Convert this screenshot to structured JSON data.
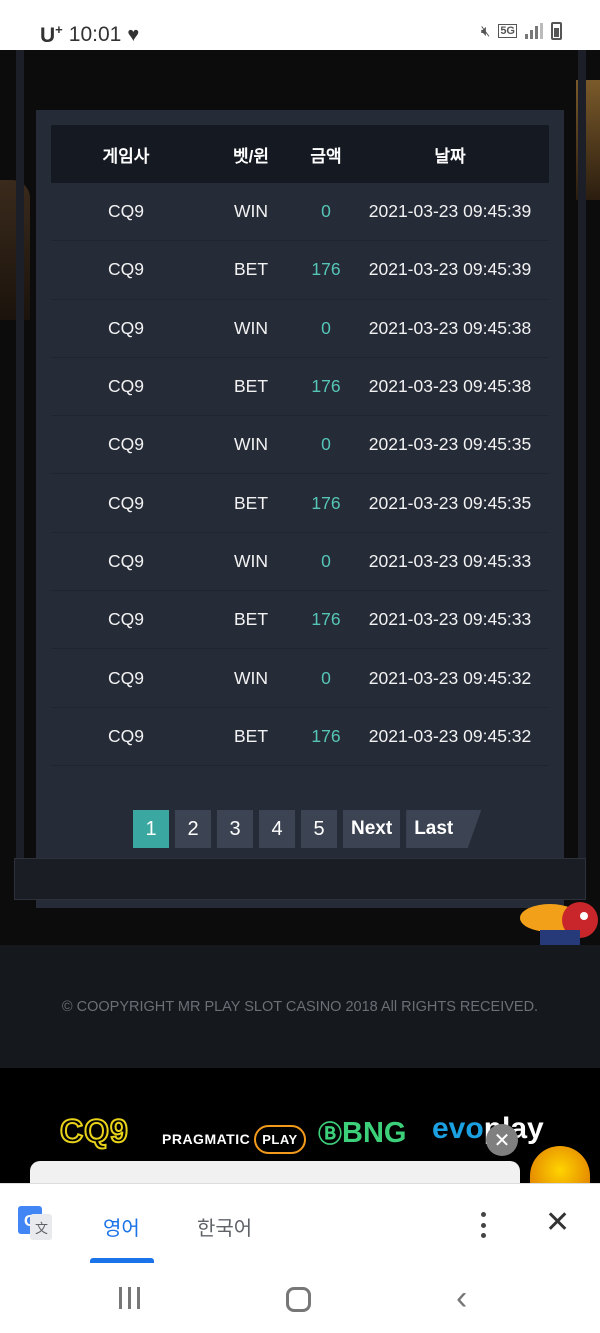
{
  "status_bar": {
    "carrier": "U",
    "carrier_sup": "+",
    "time": "10:01",
    "network": "5G"
  },
  "table": {
    "headers": [
      "게임사",
      "벳/윈",
      "금액",
      "날짜"
    ],
    "rows": [
      [
        "CQ9",
        "WIN",
        "0",
        "2021-03-23 09:45:39"
      ],
      [
        "CQ9",
        "BET",
        "176",
        "2021-03-23 09:45:39"
      ],
      [
        "CQ9",
        "WIN",
        "0",
        "2021-03-23 09:45:38"
      ],
      [
        "CQ9",
        "BET",
        "176",
        "2021-03-23 09:45:38"
      ],
      [
        "CQ9",
        "WIN",
        "0",
        "2021-03-23 09:45:35"
      ],
      [
        "CQ9",
        "BET",
        "176",
        "2021-03-23 09:45:35"
      ],
      [
        "CQ9",
        "WIN",
        "0",
        "2021-03-23 09:45:33"
      ],
      [
        "CQ9",
        "BET",
        "176",
        "2021-03-23 09:45:33"
      ],
      [
        "CQ9",
        "WIN",
        "0",
        "2021-03-23 09:45:32"
      ],
      [
        "CQ9",
        "BET",
        "176",
        "2021-03-23 09:45:32"
      ]
    ]
  },
  "pagination": {
    "pages": [
      "1",
      "2",
      "3",
      "4",
      "5"
    ],
    "current": "1",
    "next": "Next",
    "last": "Last"
  },
  "footer": {
    "copyright": "© COOPYRIGHT MR PLAY SLOT CASINO 2018 All RIGHTS RECEIVED."
  },
  "providers": {
    "cq9": "CQ9",
    "pragmatic_a": "PRAGMATIC",
    "pragmatic_b": "PLAY",
    "bng": "BNG",
    "evo_a": "evo",
    "evo_b": "play"
  },
  "translate_bar": {
    "source_lang": "영어",
    "target_lang": "한국어"
  },
  "colors": {
    "accent": "#3aa8a0",
    "amount": "#55c6b6",
    "translate_blue": "#1a73e8"
  }
}
